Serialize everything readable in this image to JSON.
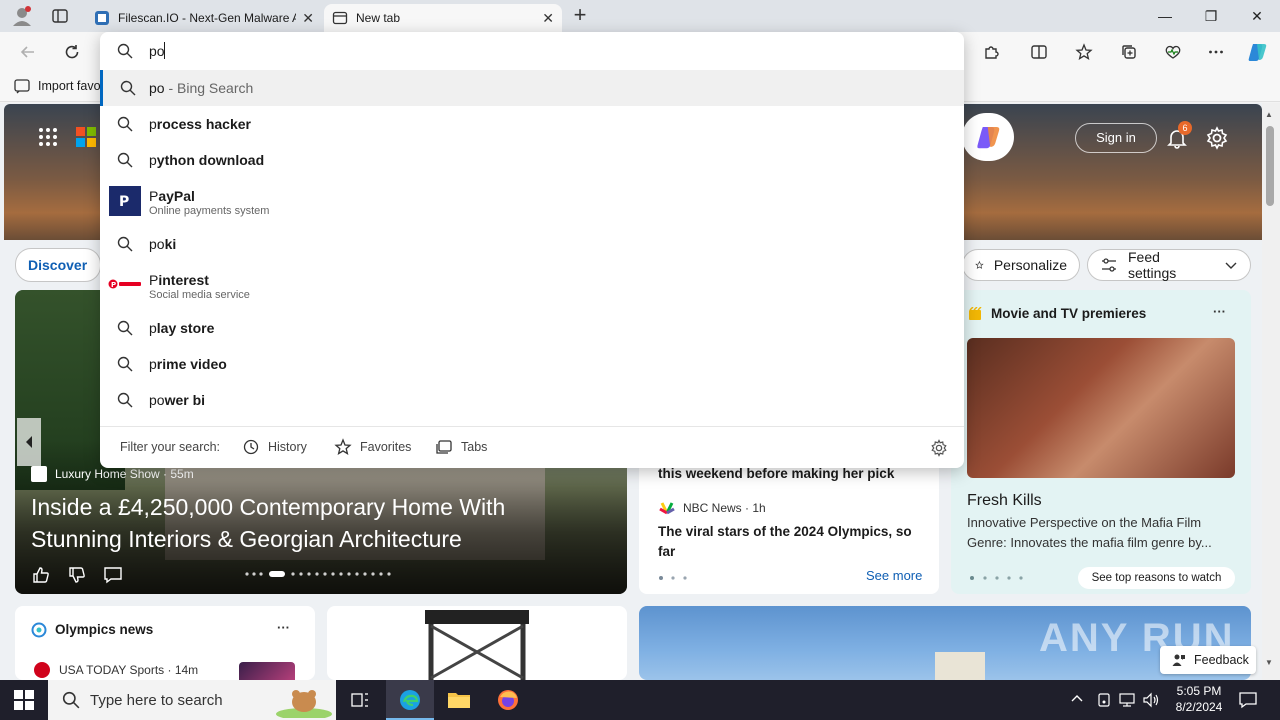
{
  "browser": {
    "tabs": [
      {
        "label": "Filescan.IO - Next-Gen Malware A",
        "close": "✕"
      },
      {
        "label": "New tab",
        "close": "✕"
      }
    ],
    "new_tab": "+",
    "window_controls": {
      "minimize": "—",
      "maximize": "❐",
      "close": "✕"
    },
    "favorites_bar": {
      "import": "Import favo"
    }
  },
  "omnibox": {
    "value": "po",
    "suggestions": [
      {
        "typed": "po",
        "rest": "",
        "suffix": " - Bing Search",
        "icon": "search-icon",
        "selected": true
      },
      {
        "typed": "p",
        "rest": "rocess hacker",
        "icon": "search-icon"
      },
      {
        "typed": "p",
        "rest": "ython download",
        "icon": "search-icon"
      },
      {
        "typed": "P",
        "rest": "ayPal",
        "sub": "Online payments system",
        "icon": "paypal-logo"
      },
      {
        "typed": "po",
        "rest": "ki",
        "icon": "search-icon"
      },
      {
        "typed": "P",
        "rest": "interest",
        "sub": "Social media service",
        "icon": "pinterest-logo"
      },
      {
        "typed": "p",
        "rest": "lay store",
        "icon": "search-icon"
      },
      {
        "typed": "p",
        "rest": "rime video",
        "icon": "search-icon"
      },
      {
        "typed": "po",
        "rest": "wer bi",
        "icon": "search-icon"
      }
    ],
    "filter": {
      "label": "Filter your search:",
      "history": "History",
      "favorites": "Favorites",
      "tabs": "Tabs"
    }
  },
  "newtab": {
    "sign_in": "Sign in",
    "notification_count": "6",
    "discover": "Discover",
    "personalize": "Personalize",
    "feed_settings": "Feed settings",
    "hero_story": {
      "source": "Luxury Home Show · 55m",
      "headline": "Inside a £4,250,000 Contemporary Home With Stunning Interiors & Georgian Architecture"
    },
    "middle_card": {
      "partial_headline": "this weekend before making her pick",
      "source": "NBC News · 1h",
      "headline": "The viral stars of the 2024 Olympics, so far",
      "see_more": "See more"
    },
    "movie_card": {
      "title": "Movie and TV premieres",
      "more": "···",
      "show_title": "Fresh Kills",
      "description": "Innovative Perspective on the Mafia Film Genre: Innovates the mafia film genre by...",
      "cta": "See top reasons to watch"
    },
    "olympics": {
      "title": "Olympics news",
      "more": "···",
      "source": "USA TODAY Sports · 14m"
    },
    "feedback": "Feedback",
    "watermark": "ANY RUN"
  },
  "taskbar": {
    "search_placeholder": "Type here to search",
    "time": "5:05 PM",
    "date": "8/2/2024"
  },
  "colors": {
    "accent": "#0067c0",
    "taskbar": "#1f1f2b",
    "tab_bar": "#dfe3e8"
  }
}
